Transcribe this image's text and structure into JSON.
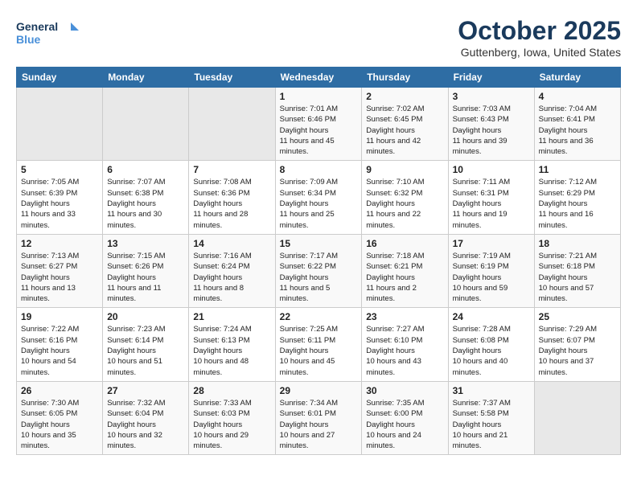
{
  "header": {
    "logo_line1": "General",
    "logo_line2": "Blue",
    "month_title": "October 2025",
    "location": "Guttenberg, Iowa, United States"
  },
  "calendar": {
    "days_of_week": [
      "Sunday",
      "Monday",
      "Tuesday",
      "Wednesday",
      "Thursday",
      "Friday",
      "Saturday"
    ],
    "weeks": [
      [
        {
          "day": "",
          "info": ""
        },
        {
          "day": "",
          "info": ""
        },
        {
          "day": "",
          "info": ""
        },
        {
          "day": "1",
          "sunrise": "7:01 AM",
          "sunset": "6:46 PM",
          "daylight": "11 hours and 45 minutes."
        },
        {
          "day": "2",
          "sunrise": "7:02 AM",
          "sunset": "6:45 PM",
          "daylight": "11 hours and 42 minutes."
        },
        {
          "day": "3",
          "sunrise": "7:03 AM",
          "sunset": "6:43 PM",
          "daylight": "11 hours and 39 minutes."
        },
        {
          "day": "4",
          "sunrise": "7:04 AM",
          "sunset": "6:41 PM",
          "daylight": "11 hours and 36 minutes."
        }
      ],
      [
        {
          "day": "5",
          "sunrise": "7:05 AM",
          "sunset": "6:39 PM",
          "daylight": "11 hours and 33 minutes."
        },
        {
          "day": "6",
          "sunrise": "7:07 AM",
          "sunset": "6:38 PM",
          "daylight": "11 hours and 30 minutes."
        },
        {
          "day": "7",
          "sunrise": "7:08 AM",
          "sunset": "6:36 PM",
          "daylight": "11 hours and 28 minutes."
        },
        {
          "day": "8",
          "sunrise": "7:09 AM",
          "sunset": "6:34 PM",
          "daylight": "11 hours and 25 minutes."
        },
        {
          "day": "9",
          "sunrise": "7:10 AM",
          "sunset": "6:32 PM",
          "daylight": "11 hours and 22 minutes."
        },
        {
          "day": "10",
          "sunrise": "7:11 AM",
          "sunset": "6:31 PM",
          "daylight": "11 hours and 19 minutes."
        },
        {
          "day": "11",
          "sunrise": "7:12 AM",
          "sunset": "6:29 PM",
          "daylight": "11 hours and 16 minutes."
        }
      ],
      [
        {
          "day": "12",
          "sunrise": "7:13 AM",
          "sunset": "6:27 PM",
          "daylight": "11 hours and 13 minutes."
        },
        {
          "day": "13",
          "sunrise": "7:15 AM",
          "sunset": "6:26 PM",
          "daylight": "11 hours and 11 minutes."
        },
        {
          "day": "14",
          "sunrise": "7:16 AM",
          "sunset": "6:24 PM",
          "daylight": "11 hours and 8 minutes."
        },
        {
          "day": "15",
          "sunrise": "7:17 AM",
          "sunset": "6:22 PM",
          "daylight": "11 hours and 5 minutes."
        },
        {
          "day": "16",
          "sunrise": "7:18 AM",
          "sunset": "6:21 PM",
          "daylight": "11 hours and 2 minutes."
        },
        {
          "day": "17",
          "sunrise": "7:19 AM",
          "sunset": "6:19 PM",
          "daylight": "10 hours and 59 minutes."
        },
        {
          "day": "18",
          "sunrise": "7:21 AM",
          "sunset": "6:18 PM",
          "daylight": "10 hours and 57 minutes."
        }
      ],
      [
        {
          "day": "19",
          "sunrise": "7:22 AM",
          "sunset": "6:16 PM",
          "daylight": "10 hours and 54 minutes."
        },
        {
          "day": "20",
          "sunrise": "7:23 AM",
          "sunset": "6:14 PM",
          "daylight": "10 hours and 51 minutes."
        },
        {
          "day": "21",
          "sunrise": "7:24 AM",
          "sunset": "6:13 PM",
          "daylight": "10 hours and 48 minutes."
        },
        {
          "day": "22",
          "sunrise": "7:25 AM",
          "sunset": "6:11 PM",
          "daylight": "10 hours and 45 minutes."
        },
        {
          "day": "23",
          "sunrise": "7:27 AM",
          "sunset": "6:10 PM",
          "daylight": "10 hours and 43 minutes."
        },
        {
          "day": "24",
          "sunrise": "7:28 AM",
          "sunset": "6:08 PM",
          "daylight": "10 hours and 40 minutes."
        },
        {
          "day": "25",
          "sunrise": "7:29 AM",
          "sunset": "6:07 PM",
          "daylight": "10 hours and 37 minutes."
        }
      ],
      [
        {
          "day": "26",
          "sunrise": "7:30 AM",
          "sunset": "6:05 PM",
          "daylight": "10 hours and 35 minutes."
        },
        {
          "day": "27",
          "sunrise": "7:32 AM",
          "sunset": "6:04 PM",
          "daylight": "10 hours and 32 minutes."
        },
        {
          "day": "28",
          "sunrise": "7:33 AM",
          "sunset": "6:03 PM",
          "daylight": "10 hours and 29 minutes."
        },
        {
          "day": "29",
          "sunrise": "7:34 AM",
          "sunset": "6:01 PM",
          "daylight": "10 hours and 27 minutes."
        },
        {
          "day": "30",
          "sunrise": "7:35 AM",
          "sunset": "6:00 PM",
          "daylight": "10 hours and 24 minutes."
        },
        {
          "day": "31",
          "sunrise": "7:37 AM",
          "sunset": "5:58 PM",
          "daylight": "10 hours and 21 minutes."
        },
        {
          "day": "",
          "info": ""
        }
      ]
    ]
  }
}
